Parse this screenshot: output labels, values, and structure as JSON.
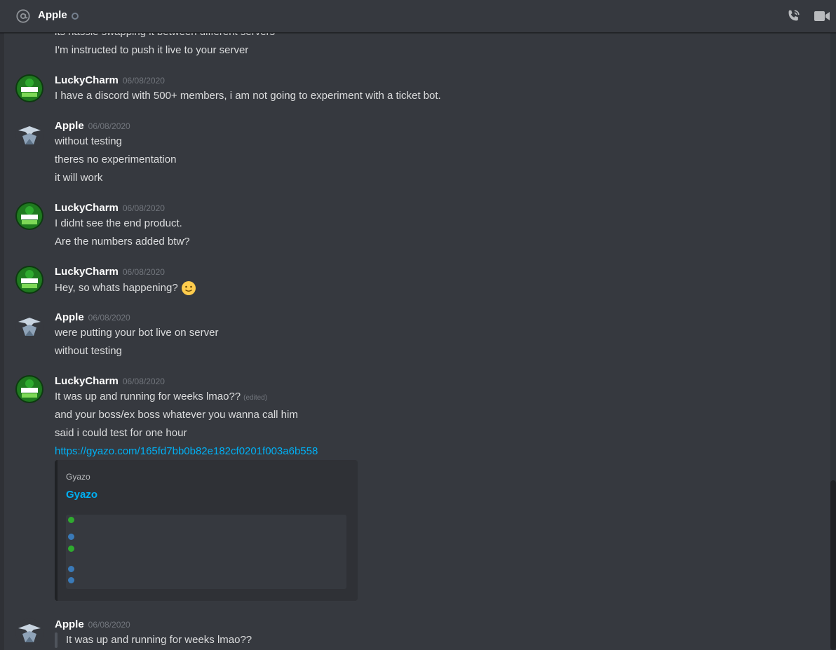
{
  "header": {
    "title": "Apple",
    "icons": [
      "at-icon",
      "status-offline-icon",
      "call-icon",
      "video-icon"
    ]
  },
  "top_lines": [
    "its hassle swapping it between different servers",
    "I'm instructed to push it live to your server"
  ],
  "groups": [
    {
      "author": "LuckyCharm",
      "timestamp": "06/08/2020",
      "avatar": "luckycharm-avatar",
      "lines": [
        "I have a discord with 500+ members, i am not going to experiment with a ticket bot."
      ]
    },
    {
      "author": "Apple",
      "timestamp": "06/08/2020",
      "avatar": "apple-avatar",
      "lines": [
        "without testing",
        "theres no experimentation",
        "it will work"
      ]
    },
    {
      "author": "LuckyCharm",
      "timestamp": "06/08/2020",
      "avatar": "luckycharm-avatar",
      "lines": [
        "I didnt see the end product.",
        "Are the numbers added btw?"
      ]
    },
    {
      "author": "LuckyCharm",
      "timestamp": "06/08/2020",
      "avatar": "luckycharm-avatar",
      "lines": [
        "Hey, so whats happening?"
      ],
      "emoji": "slightly-smiling-face-icon"
    },
    {
      "author": "Apple",
      "timestamp": "06/08/2020",
      "avatar": "apple-avatar",
      "lines": [
        "were putting your bot live on server",
        "without testing"
      ]
    },
    {
      "author": "LuckyCharm",
      "timestamp": "06/08/2020",
      "avatar": "luckycharm-avatar",
      "lines": [
        "It was up and running for weeks lmao??",
        "and your boss/ex boss whatever you wanna call him",
        "said i could test for one hour"
      ],
      "edited_label": "(edited)",
      "link": "https://gyazo.com/165fd7bb0b82e182cf0201f003a6b558",
      "embed": {
        "provider": "Gyazo",
        "title": "Gyazo"
      }
    },
    {
      "author": "Apple",
      "timestamp": "06/08/2020",
      "avatar": "apple-avatar",
      "quote": "It was up and running for weeks lmao??"
    }
  ],
  "colors": {
    "background": "#36393f",
    "link": "#00b0f4",
    "timestamp": "#72767d",
    "text": "#dcddde"
  }
}
